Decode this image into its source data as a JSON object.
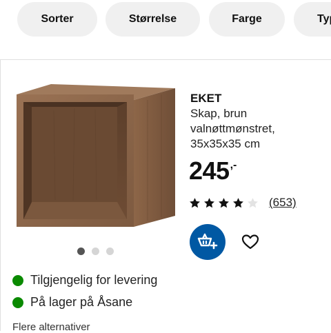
{
  "filters": [
    "Sorter",
    "Størrelse",
    "Farge",
    "Typ"
  ],
  "product": {
    "name": "EKET",
    "description": "Skap, brun valnøttmønstret, 35x35x35 cm",
    "price_integer": "245",
    "price_suffix": ",-",
    "rating": 4,
    "rating_max": 5,
    "review_count": "(653)",
    "image_dots": 3,
    "active_image": 1
  },
  "availability": [
    {
      "label": "Tilgjengelig for levering",
      "status_color": "#0a8a00"
    },
    {
      "label": "På lager på Åsane",
      "status_color": "#0a8a00"
    }
  ],
  "more_alternatives": "Flere alternativer",
  "colors": {
    "accent": "#0058a3",
    "available": "#0a8a00",
    "chip_bg": "#f0f0f0",
    "wood": "#8a6448"
  },
  "icons": {
    "cart": "add-to-cart-icon",
    "heart": "heart-outline-icon"
  }
}
